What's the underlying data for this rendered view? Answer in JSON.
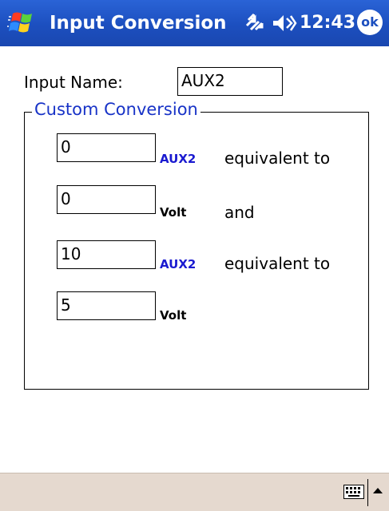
{
  "titlebar": {
    "app_title": "Input Conversion",
    "clock": "12:43",
    "ok_label": "ok",
    "icons": [
      "windows-start-icon",
      "connectivity-icon",
      "volume-icon"
    ]
  },
  "form": {
    "input_name_label": "Input Name:",
    "input_name_value": "AUX2",
    "group_title": "Custom Conversion",
    "rows": [
      {
        "value": "0",
        "unit": "AUX2",
        "suffix": "equivalent to"
      },
      {
        "value": "0",
        "unit": "Volt",
        "suffix": "and"
      },
      {
        "value": "10",
        "unit": "AUX2",
        "suffix": "equivalent to"
      },
      {
        "value": "5",
        "unit": "Volt",
        "suffix": ""
      }
    ]
  },
  "bottombar": {
    "icons": [
      "keyboard-icon",
      "sip-arrow-up-icon"
    ]
  },
  "colors": {
    "titlebar_blue": "#1c4fbf",
    "group_title_blue": "#1833c7",
    "unit_blue": "#1a1ad0",
    "bottombar_beige": "#e5d9cf"
  }
}
